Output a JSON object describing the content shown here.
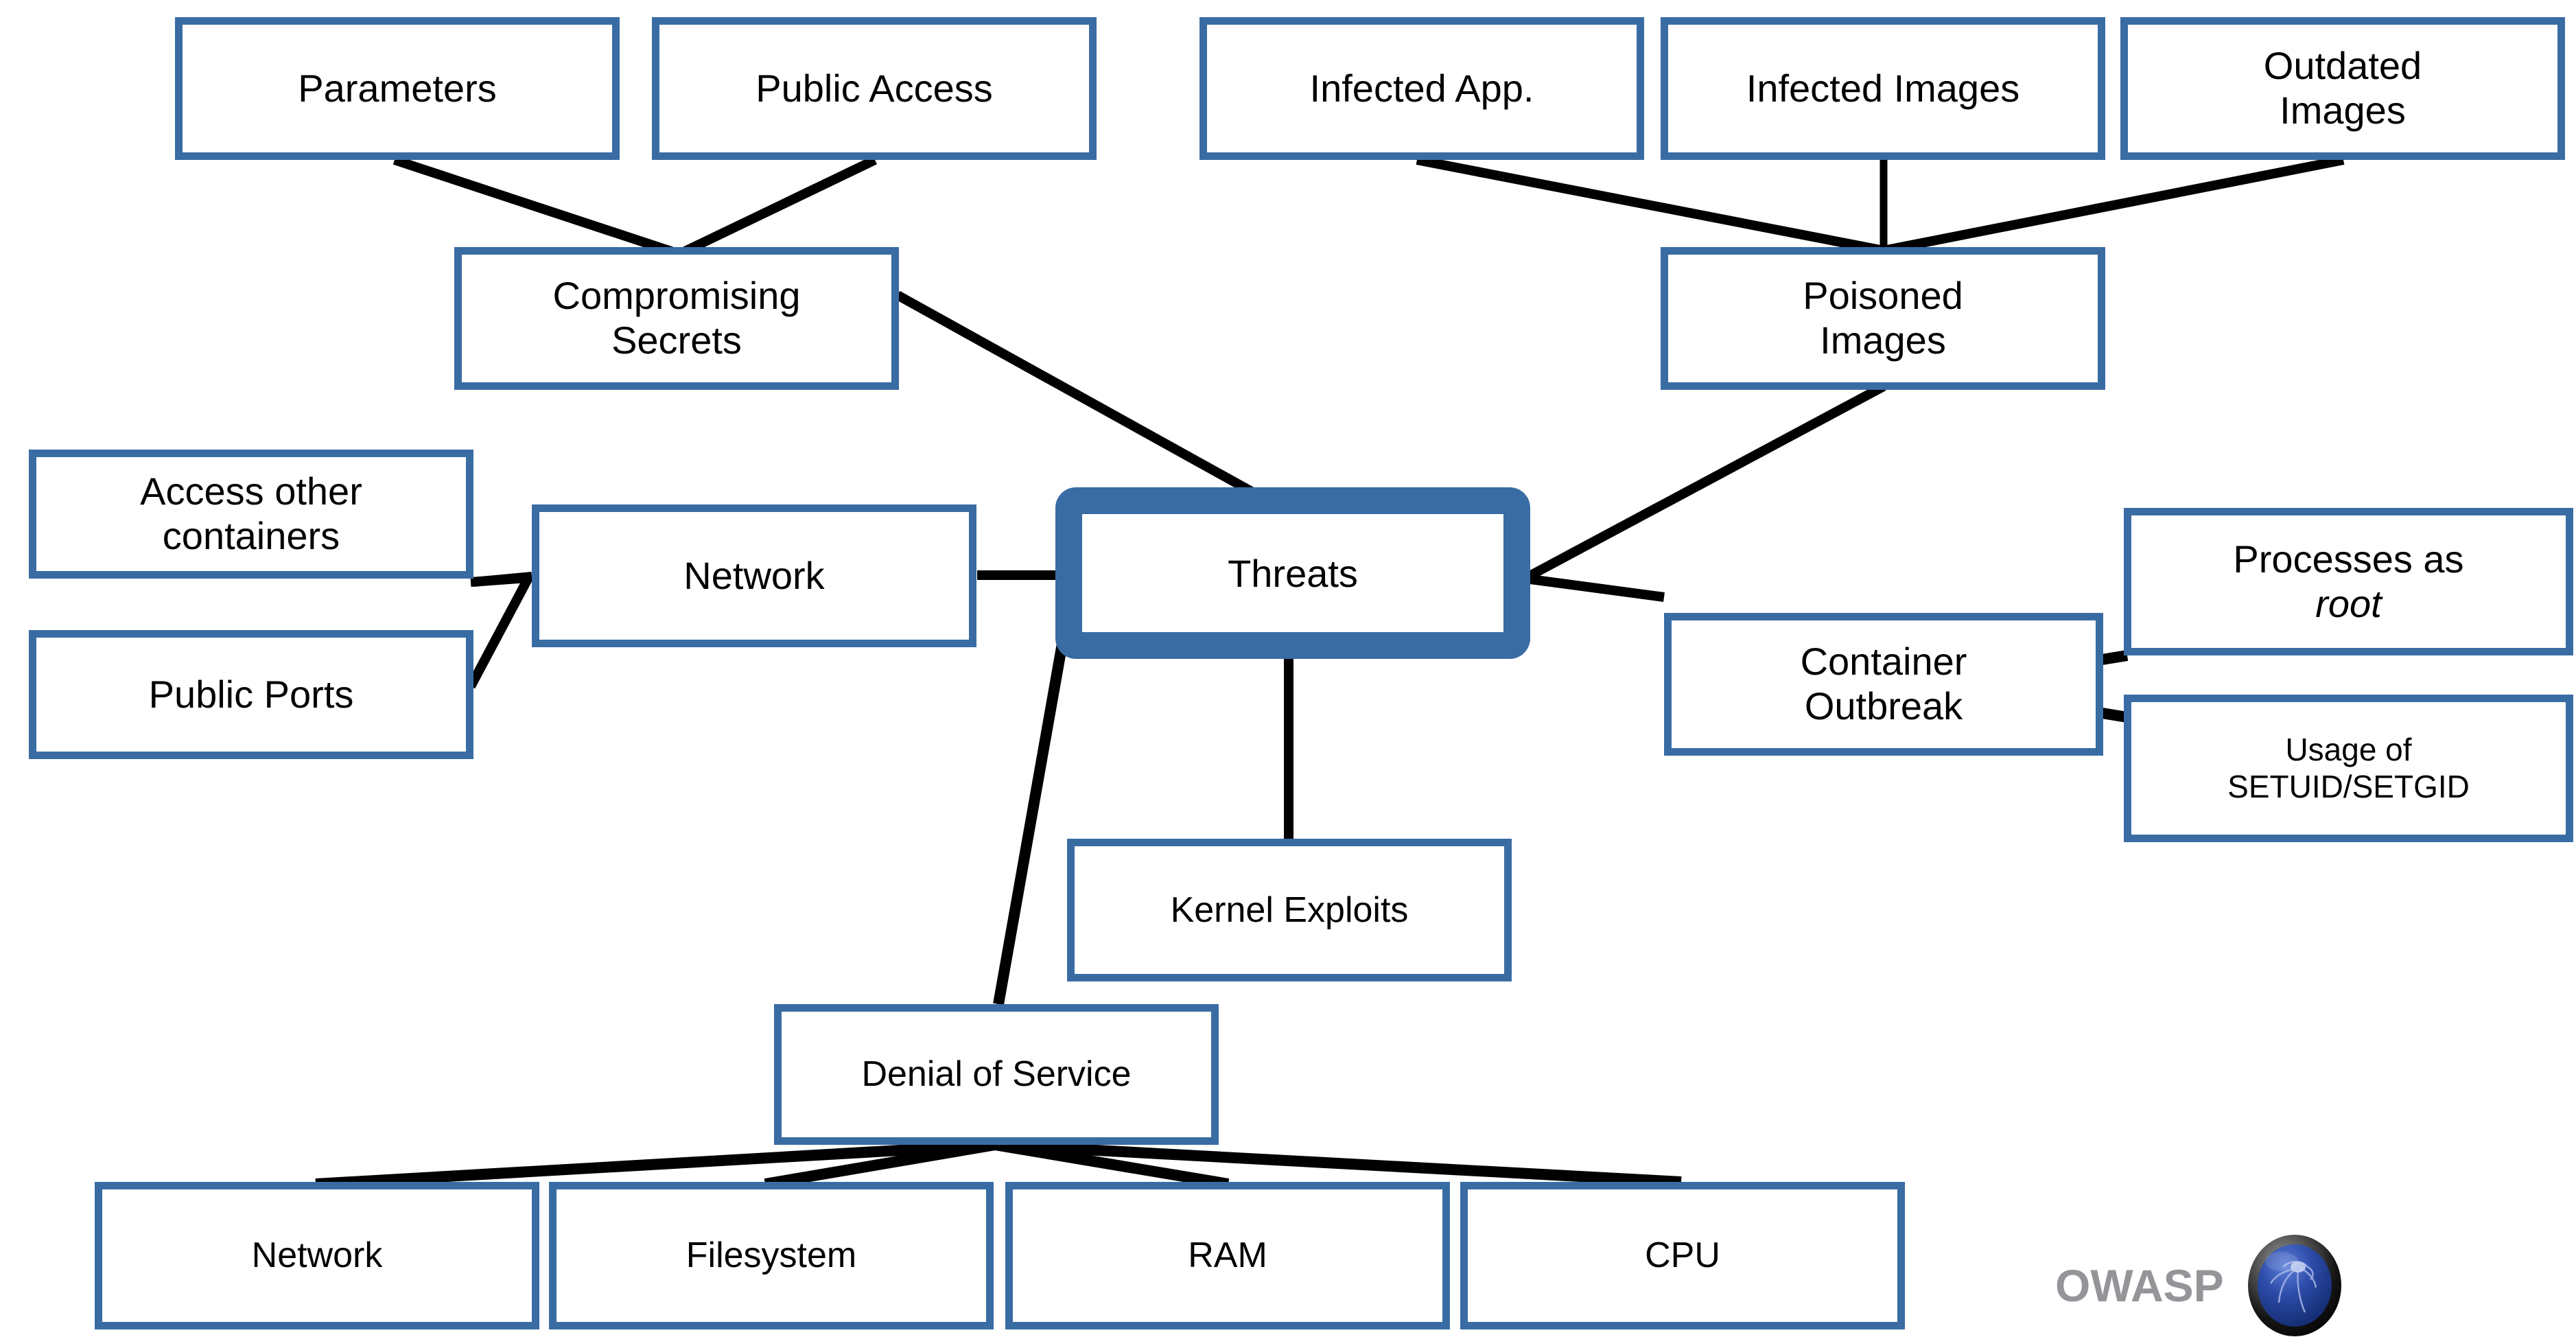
{
  "diagram": {
    "title": "Threats",
    "type": "mind-map",
    "colors": {
      "node_border": "#3a6ca4",
      "node_fill": "#ffffff",
      "root_fill": "#3a6ca4",
      "edge": "#000000",
      "text": "#000000",
      "logo_text": "#939598",
      "background": "#ffffff"
    },
    "root": {
      "label": "Threats"
    },
    "nodes": [
      {
        "id": "parameters",
        "label": "Parameters"
      },
      {
        "id": "public-access",
        "label": "Public Access"
      },
      {
        "id": "compromising-secrets",
        "label": "Compromising\nSecrets"
      },
      {
        "id": "infected-app",
        "label": "Infected App."
      },
      {
        "id": "infected-images",
        "label": "Infected Images"
      },
      {
        "id": "outdated-images",
        "label": "Outdated\nImages"
      },
      {
        "id": "poisoned-images",
        "label": "Poisoned\nImages"
      },
      {
        "id": "access-other-containers",
        "label": "Access other\ncontainers"
      },
      {
        "id": "public-ports",
        "label": "Public Ports"
      },
      {
        "id": "network",
        "label": "Network"
      },
      {
        "id": "container-outbreak",
        "label": "Container\nOutbreak"
      },
      {
        "id": "processes-as-root-line1",
        "label": "Processes as"
      },
      {
        "id": "processes-as-root-line2",
        "label": "root"
      },
      {
        "id": "usage-setuid-line1",
        "label": "Usage of"
      },
      {
        "id": "usage-setuid-line2",
        "label": "SETUID/SETGID"
      },
      {
        "id": "kernel-exploits",
        "label": "Kernel Exploits"
      },
      {
        "id": "denial-of-service",
        "label": "Denial of Service"
      },
      {
        "id": "dos-network",
        "label": "Network"
      },
      {
        "id": "dos-filesystem",
        "label": "Filesystem"
      },
      {
        "id": "dos-ram",
        "label": "RAM"
      },
      {
        "id": "dos-cpu",
        "label": "CPU"
      }
    ],
    "edges": [
      {
        "from": "parameters",
        "to": "compromising-secrets"
      },
      {
        "from": "public-access",
        "to": "compromising-secrets"
      },
      {
        "from": "compromising-secrets",
        "to": "threats"
      },
      {
        "from": "infected-app",
        "to": "poisoned-images"
      },
      {
        "from": "infected-images",
        "to": "poisoned-images"
      },
      {
        "from": "outdated-images",
        "to": "poisoned-images"
      },
      {
        "from": "poisoned-images",
        "to": "threats"
      },
      {
        "from": "access-other-containers",
        "to": "network"
      },
      {
        "from": "public-ports",
        "to": "network"
      },
      {
        "from": "network",
        "to": "threats"
      },
      {
        "from": "container-outbreak",
        "to": "threats"
      },
      {
        "from": "processes-as-root",
        "to": "container-outbreak"
      },
      {
        "from": "usage-setuid-setgid",
        "to": "container-outbreak"
      },
      {
        "from": "kernel-exploits",
        "to": "threats"
      },
      {
        "from": "denial-of-service",
        "to": "threats"
      },
      {
        "from": "dos-network",
        "to": "denial-of-service"
      },
      {
        "from": "dos-filesystem",
        "to": "denial-of-service"
      },
      {
        "from": "dos-ram",
        "to": "denial-of-service"
      },
      {
        "from": "dos-cpu",
        "to": "denial-of-service"
      }
    ]
  },
  "logo": {
    "wordmark": "OWASP",
    "badge_icon": "owasp-mosquito-badge-icon"
  }
}
